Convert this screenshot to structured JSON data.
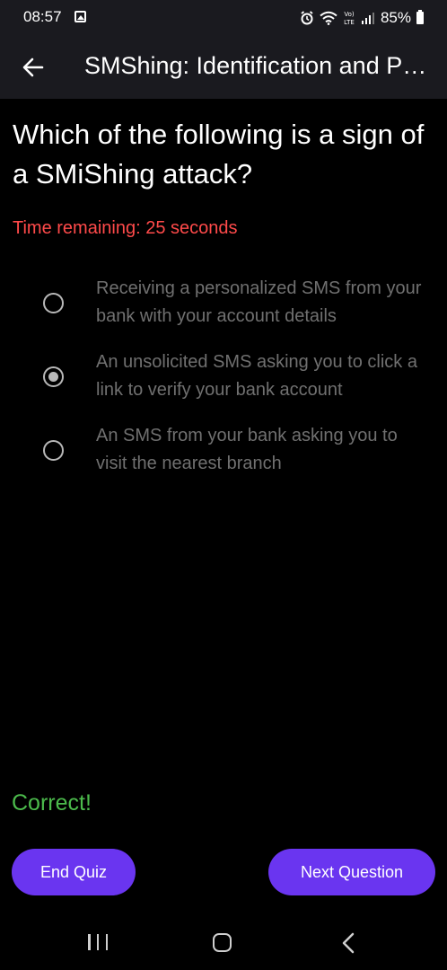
{
  "status_bar": {
    "time": "08:57",
    "battery": "85%",
    "icons": [
      "gallery-icon",
      "alarm-icon",
      "wifi-icon",
      "volte-icon",
      "signal-icon",
      "battery-icon"
    ]
  },
  "app_bar": {
    "title": "SMShing: Identification and Prevention",
    "back_icon": "arrow-left-icon"
  },
  "quiz": {
    "question": "Which of the following is a sign of a SMiShing attack?",
    "timer": "Time remaining: 25 seconds",
    "options": [
      {
        "label": "Receiving a personalized SMS from your bank with your account details",
        "selected": false
      },
      {
        "label": "An unsolicited SMS asking you to click a link to verify your bank account",
        "selected": true
      },
      {
        "label": "An SMS from your bank asking you to visit the nearest branch",
        "selected": false
      }
    ],
    "feedback": "Correct!"
  },
  "actions": {
    "end_quiz": "End Quiz",
    "next_question": "Next Question"
  },
  "colors": {
    "accent": "#6a35f0",
    "timer": "#ff4a4a",
    "correct": "#4cbb4c",
    "app_bar": "#1a1a1f"
  },
  "nav_bar": {
    "icons": [
      "recents-icon",
      "home-icon",
      "back-icon"
    ]
  }
}
